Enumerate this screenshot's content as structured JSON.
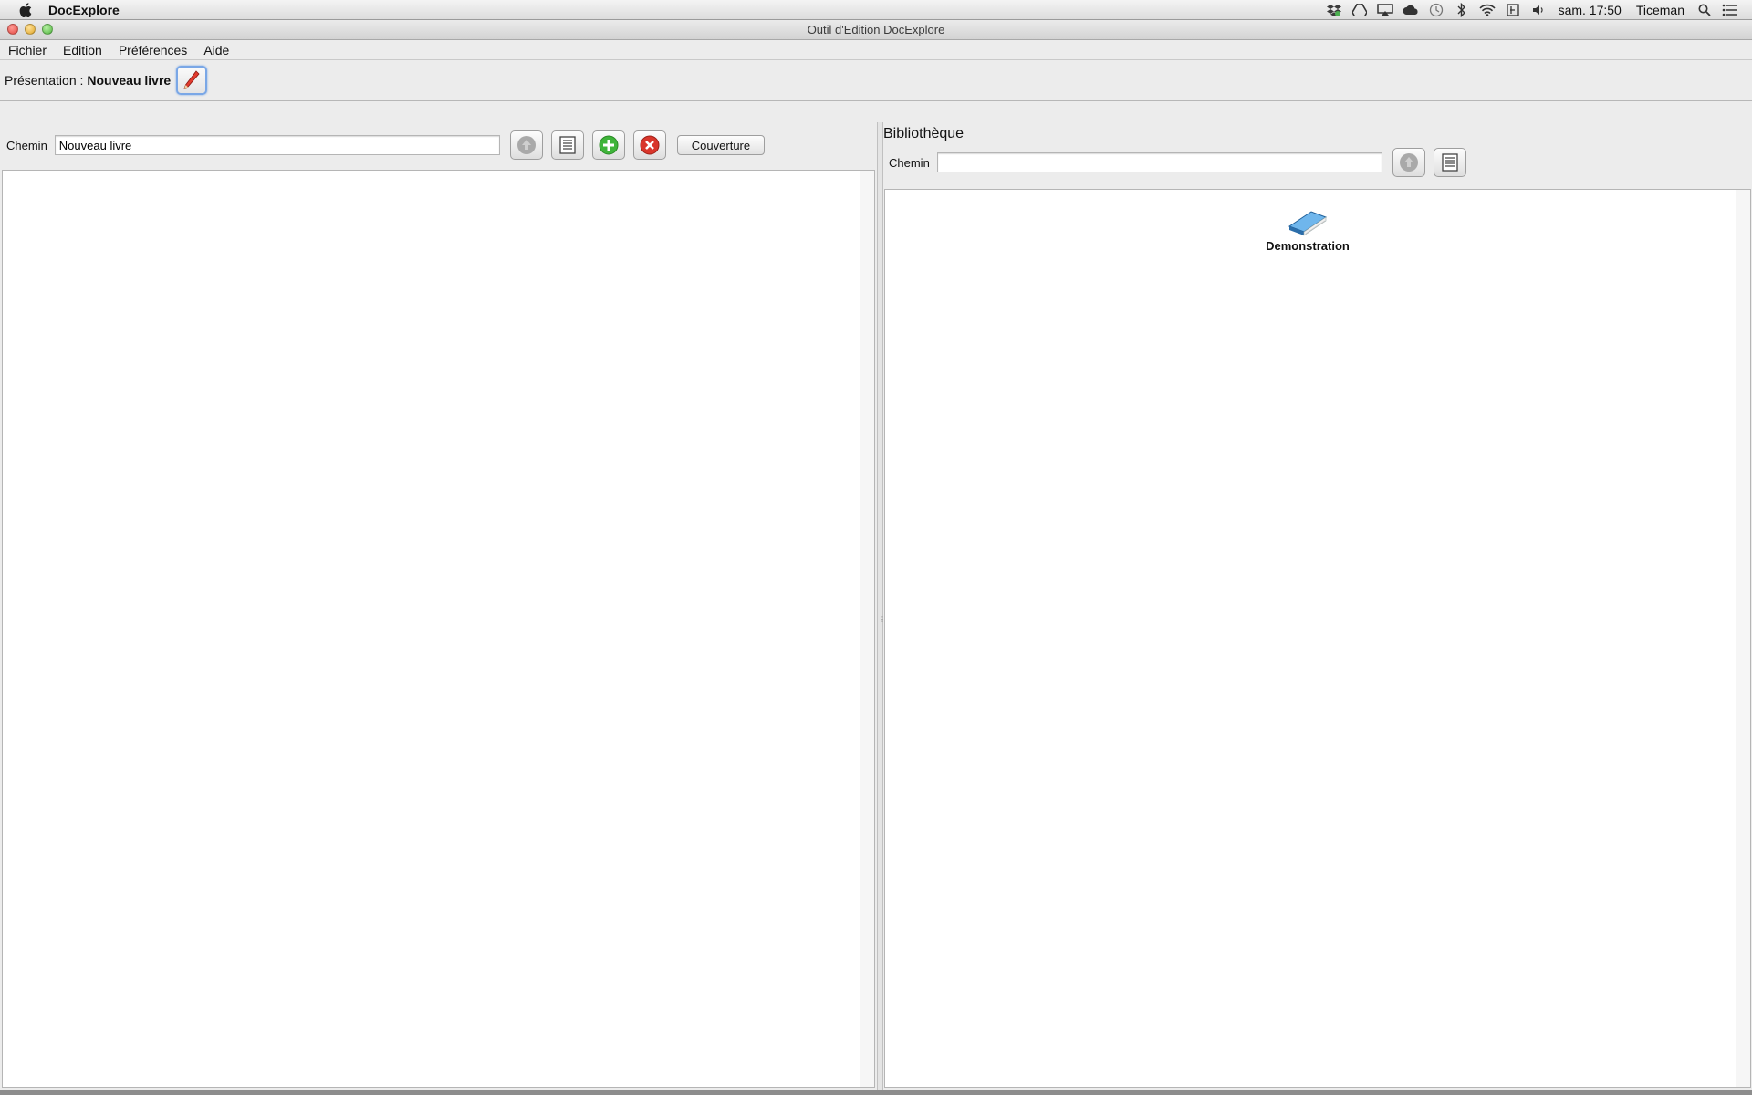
{
  "menubar": {
    "app_name": "DocExplore",
    "clock": "sam. 17:50",
    "user": "Ticeman",
    "tray_icons": [
      "dropbox-icon",
      "google-drive-icon",
      "airplay-icon",
      "cloud-icon",
      "time-machine-icon",
      "bluetooth-icon",
      "wifi-icon",
      "battery-icon",
      "volume-icon",
      "spotlight-icon",
      "notification-list-icon"
    ]
  },
  "window": {
    "title": "Outil d'Edition DocExplore"
  },
  "app_menu": {
    "items": [
      "Fichier",
      "Edition",
      "Préférences",
      "Aide"
    ]
  },
  "presentation": {
    "label": "Présentation :",
    "title": "Nouveau livre"
  },
  "left_pane": {
    "path_label": "Chemin",
    "path_value": "Nouveau livre",
    "cover_button": "Couverture"
  },
  "library": {
    "title": "Bibliothèque",
    "path_label": "Chemin",
    "path_value": "",
    "items": [
      {
        "label": "Demonstration",
        "icon": "book-icon"
      }
    ]
  },
  "colors": {
    "add_green": "#3fb43a",
    "delete_red": "#d9362b",
    "book_blue": "#3a86c8",
    "focus_blue": "#7aa7e6"
  }
}
